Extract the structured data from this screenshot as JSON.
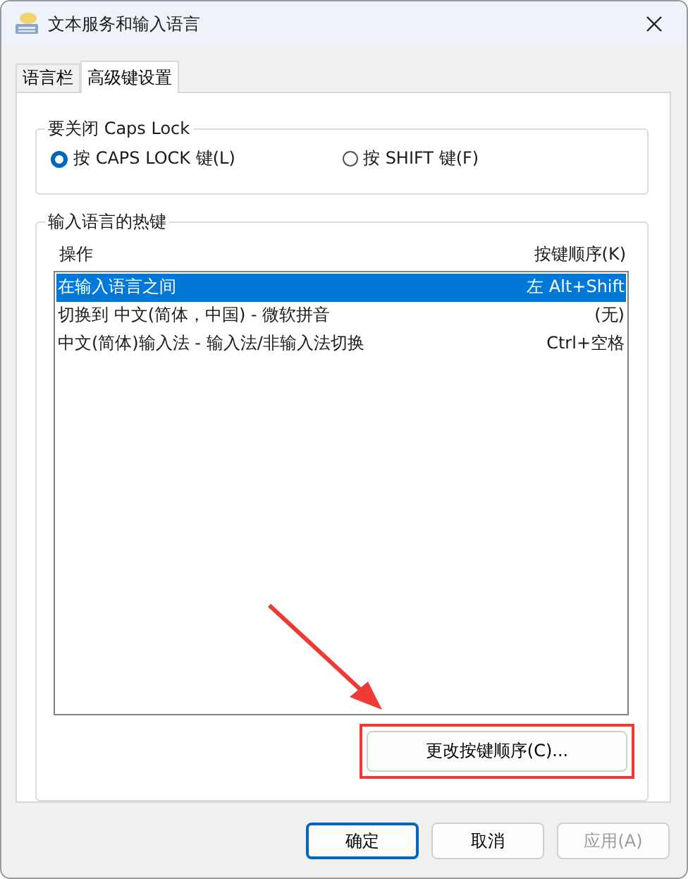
{
  "window": {
    "title": "文本服务和输入语言"
  },
  "tabs": [
    {
      "label": "语言栏",
      "selected": false
    },
    {
      "label": "高级键设置",
      "selected": true
    }
  ],
  "caps_lock_group": {
    "title": "要关闭 Caps Lock",
    "options": [
      {
        "label": "按 CAPS LOCK 键(L)",
        "selected": true
      },
      {
        "label": "按 SHIFT 键(F)",
        "selected": false
      }
    ]
  },
  "hotkeys_group": {
    "title": "输入语言的热键",
    "columns": [
      "操作",
      "按键顺序(K)"
    ],
    "rows": [
      {
        "action": "在输入语言之间",
        "keys": "左 Alt+Shift",
        "selected": true
      },
      {
        "action": "切换到 中文(简体，中国) - 微软拼音",
        "keys": "(无)",
        "selected": false
      },
      {
        "action": "中文(简体)输入法 - 输入法/非输入法切换",
        "keys": "Ctrl+空格",
        "selected": false
      }
    ],
    "change_button": {
      "label": "更改按键顺序(C)...",
      "highlighted": true
    }
  },
  "buttons": [
    {
      "label": "确定",
      "default": true,
      "disabled": false
    },
    {
      "label": "取消",
      "default": false,
      "disabled": false
    },
    {
      "label": "应用(A)",
      "default": false,
      "disabled": true
    }
  ]
}
